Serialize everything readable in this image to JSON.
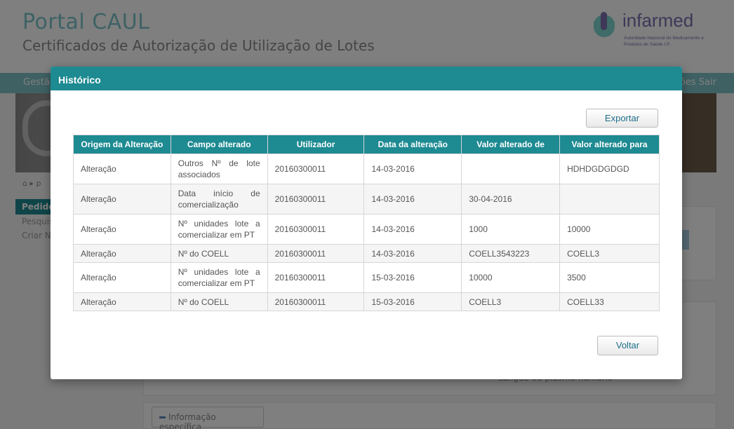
{
  "header": {
    "title": "Portal CAUL",
    "subtitle": "Certificados de Autorização de Utilização de Lotes",
    "logo_name": "infarmed",
    "logo_sub": "Autoridade Nacional do Medicamento e Produtos de Saúde I.P."
  },
  "nav": {
    "left": "Gestã",
    "right": "ões Sair"
  },
  "breadcrumb": "p",
  "sidebar": {
    "active": "Pedido",
    "items": [
      "Pesquis",
      "Criar N"
    ]
  },
  "background": {
    "text": "sangue ou plasma humano",
    "info_button": "Informação específica"
  },
  "modal": {
    "title": "Histórico",
    "export_label": "Exportar",
    "back_label": "Voltar",
    "columns": [
      "Origem da Alteração",
      "Campo alterado",
      "Utilizador",
      "Data da alteração",
      "Valor alterado de",
      "Valor alterado para"
    ],
    "rows": [
      [
        "Alteração",
        "Outros Nº de lote associados",
        "20160300011",
        "14-03-2016",
        "",
        "HDHDGDGDGD"
      ],
      [
        "Alteração",
        "Data início de comercialização",
        "20160300011",
        "14-03-2016",
        "30-04-2016",
        ""
      ],
      [
        "Alteração",
        "Nº unidades lote a comercializar em PT",
        "20160300011",
        "14-03-2016",
        "1000",
        "10000"
      ],
      [
        "Alteração",
        "Nº do COELL",
        "20160300011",
        "14-03-2016",
        "COELL3543223",
        "COELL3"
      ],
      [
        "Alteração",
        "Nº unidades lote a comercializar em PT",
        "20160300011",
        "15-03-2016",
        "10000",
        "3500"
      ],
      [
        "Alteração",
        "Nº do COELL",
        "20160300011",
        "15-03-2016",
        "COELL3",
        "COELL33"
      ]
    ]
  },
  "colors": {
    "accent": "#1e8a92",
    "nav": "#7fc3c8",
    "brand": "#7c6fb0"
  }
}
